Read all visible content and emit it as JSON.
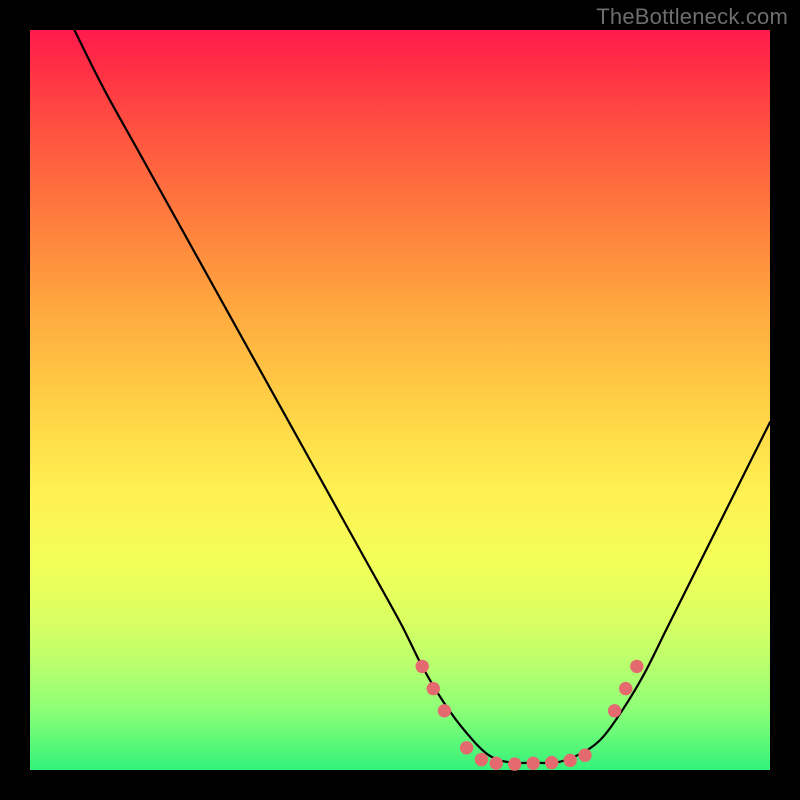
{
  "watermark": "TheBottleneck.com",
  "chart_data": {
    "type": "line",
    "title": "",
    "xlabel": "",
    "ylabel": "",
    "xlim": [
      0,
      100
    ],
    "ylim": [
      0,
      100
    ],
    "series": [
      {
        "name": "curve",
        "x": [
          6,
          10,
          15,
          20,
          25,
          30,
          35,
          40,
          45,
          50,
          53,
          56,
          59,
          62,
          65,
          68,
          71,
          74,
          77,
          80,
          83,
          86,
          89,
          92,
          95,
          98,
          100
        ],
        "y": [
          100,
          92,
          83,
          74,
          65,
          56,
          47,
          38,
          29,
          20,
          14,
          9,
          5,
          2,
          1,
          1,
          1,
          2,
          4,
          8,
          13,
          19,
          25,
          31,
          37,
          43,
          47
        ]
      }
    ],
    "markers": {
      "name": "dots",
      "color": "#e46a6f",
      "radius_pct": 0.9,
      "points": [
        {
          "x": 53,
          "y": 14
        },
        {
          "x": 54.5,
          "y": 11
        },
        {
          "x": 56,
          "y": 8
        },
        {
          "x": 59,
          "y": 3
        },
        {
          "x": 61,
          "y": 1.4
        },
        {
          "x": 63,
          "y": 0.9
        },
        {
          "x": 65.5,
          "y": 0.8
        },
        {
          "x": 68,
          "y": 0.9
        },
        {
          "x": 70.5,
          "y": 1.0
        },
        {
          "x": 73,
          "y": 1.3
        },
        {
          "x": 75,
          "y": 2.0
        },
        {
          "x": 79,
          "y": 8
        },
        {
          "x": 80.5,
          "y": 11
        },
        {
          "x": 82,
          "y": 14
        }
      ]
    },
    "background_gradient": {
      "top": "#ff1a4d",
      "mid": "#fff051",
      "bottom": "#33f37a"
    }
  }
}
